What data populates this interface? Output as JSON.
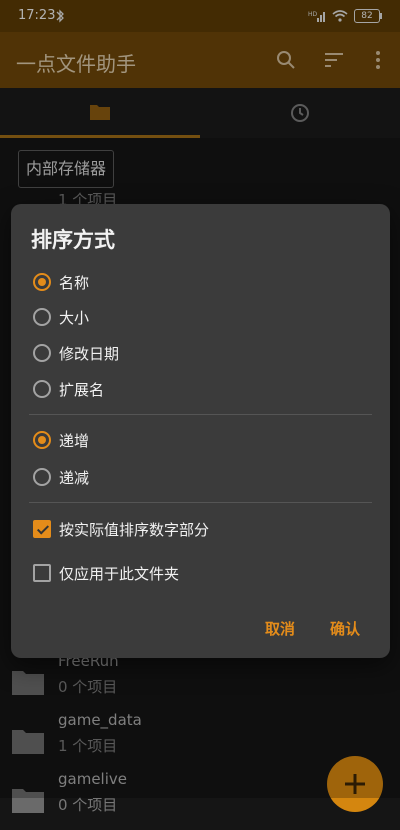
{
  "status_bar": {
    "time": "17:23",
    "network": "HD",
    "battery": "82"
  },
  "app_bar": {
    "title": "一点文件助手"
  },
  "tabs": [
    {
      "icon": "folder-icon",
      "selected": true
    },
    {
      "icon": "clock-icon",
      "selected": false
    }
  ],
  "breadcrumb": {
    "label": "内部存储器"
  },
  "background": {
    "root_count": "1 个项目"
  },
  "files": [
    {
      "name": "FreeRun",
      "count": "0 个项目"
    },
    {
      "name": "game_data",
      "count": "1 个项目"
    },
    {
      "name": "gamelive",
      "count": "0 个项目"
    }
  ],
  "dialog": {
    "title": "排序方式",
    "sort_fields": [
      {
        "label": "名称",
        "selected": true
      },
      {
        "label": "大小",
        "selected": false
      },
      {
        "label": "修改日期",
        "selected": false
      },
      {
        "label": "扩展名",
        "selected": false
      }
    ],
    "order": [
      {
        "label": "递增",
        "selected": true
      },
      {
        "label": "递减",
        "selected": false
      }
    ],
    "options": [
      {
        "label": "按实际值排序数字部分",
        "checked": true
      },
      {
        "label": "仅应用于此文件夹",
        "checked": false
      }
    ],
    "cancel_label": "取消",
    "confirm_label": "确认"
  },
  "colors": {
    "accent": "#e48c1a",
    "app_bar": "#6b4508",
    "status_bar": "#5a3a05",
    "dialog_bg": "#3b3b3b"
  }
}
